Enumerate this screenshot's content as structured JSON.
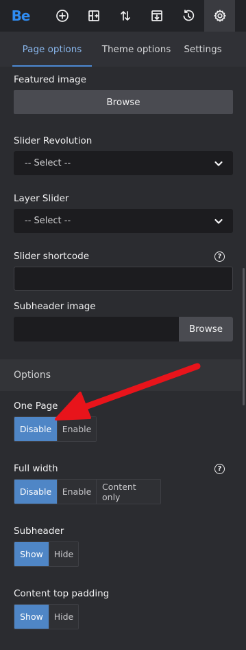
{
  "toolbar": {
    "logo": "Be",
    "buttons": [
      "add-icon",
      "add-section-icon",
      "sort-icon",
      "export-icon",
      "history-icon",
      "settings-icon"
    ]
  },
  "tabs": [
    {
      "label": "Page options",
      "active": true
    },
    {
      "label": "Theme options",
      "active": false
    },
    {
      "label": "Settings",
      "active": false
    }
  ],
  "fields": {
    "featured_image": {
      "label": "Featured image",
      "button": "Browse"
    },
    "slider_revolution": {
      "label": "Slider Revolution",
      "value": "-- Select --"
    },
    "layer_slider": {
      "label": "Layer Slider",
      "value": "-- Select --"
    },
    "slider_shortcode": {
      "label": "Slider shortcode",
      "value": ""
    },
    "subheader_image": {
      "label": "Subheader image",
      "button": "Browse",
      "value": ""
    }
  },
  "options_section": {
    "title": "Options"
  },
  "one_page": {
    "label": "One Page",
    "options": [
      "Disable",
      "Enable"
    ],
    "selected": "Disable"
  },
  "full_width": {
    "label": "Full width",
    "options": [
      "Disable",
      "Enable",
      "Content only"
    ],
    "selected": "Disable"
  },
  "subheader": {
    "label": "Subheader",
    "options": [
      "Show",
      "Hide"
    ],
    "selected": "Show"
  },
  "content_top_padding": {
    "label": "Content top padding",
    "options": [
      "Show",
      "Hide"
    ],
    "selected": "Show"
  },
  "help_glyph": "?",
  "colors": {
    "accent": "#4f86c6",
    "logo": "#2f8cf2",
    "annotation_arrow": "#e8141b"
  }
}
